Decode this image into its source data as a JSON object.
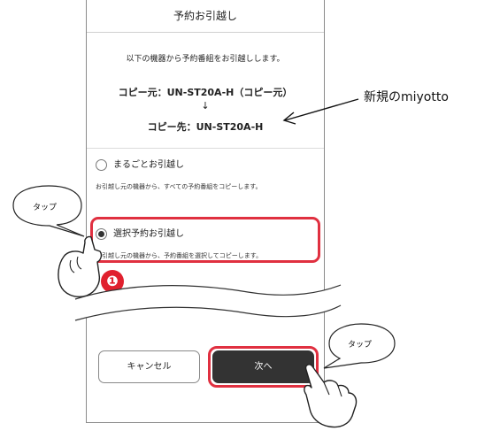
{
  "dialog": {
    "title": "予約お引越し",
    "intro": "以下の機器から予約番組をお引越しします。",
    "copy_source": "コピー元：UN-ST20A-H（コピー元）",
    "arrow": "↓",
    "copy_destination": "コピー先：UN-ST20A-H"
  },
  "options": [
    {
      "label": "まるごとお引越し",
      "description": "お引越し元の機器から、すべての予約番組をコピーします。",
      "selected": false
    },
    {
      "label": "選択予約お引越し",
      "description": "お引越し元の機器から、予約番組を選択してコピーします。",
      "selected": true
    }
  ],
  "buttons": {
    "cancel_label": "キャンセル",
    "next_label": "次へ"
  },
  "annotations": {
    "new_device_note": "新規のmiyotto",
    "tap_left": "タップ",
    "tap_right": "タップ",
    "step_number": "❶"
  },
  "colors": {
    "highlight": "#e03040",
    "primary_button": "#333333"
  }
}
